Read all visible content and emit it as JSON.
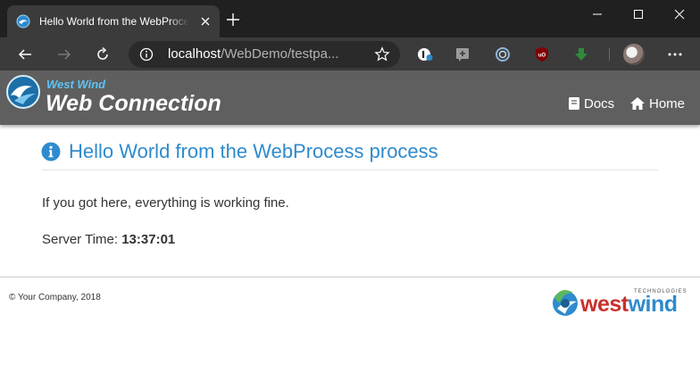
{
  "browser": {
    "tab_title": "Hello World from the WebProcess process",
    "address": {
      "host": "localhost",
      "path": "/WebDemo/testpa..."
    },
    "extensions": [
      "lastpass-icon",
      "sticky-note-icon",
      "circle-extension-icon",
      "ublock-icon",
      "download-arrow-icon"
    ]
  },
  "site": {
    "brand": {
      "small": "West Wind",
      "large": "Web Connection"
    },
    "nav": [
      {
        "label": "Docs",
        "icon": "book-icon"
      },
      {
        "label": "Home",
        "icon": "home-icon"
      }
    ]
  },
  "content": {
    "heading": "Hello World from the WebProcess process",
    "message": "If you got here, everything is working fine.",
    "server_time_label": "Server Time:",
    "server_time_value": "13:37:01"
  },
  "footer": {
    "copyright": "© Your Company, 2018",
    "logo": {
      "west": "west",
      "wind": "wind",
      "tagline": "TECHNOLOGIES"
    }
  },
  "colors": {
    "accent": "#2e8bcd",
    "header_bg": "#5f5f5f",
    "brand_small": "#5ec3f5",
    "logo_red": "#c9302c"
  }
}
